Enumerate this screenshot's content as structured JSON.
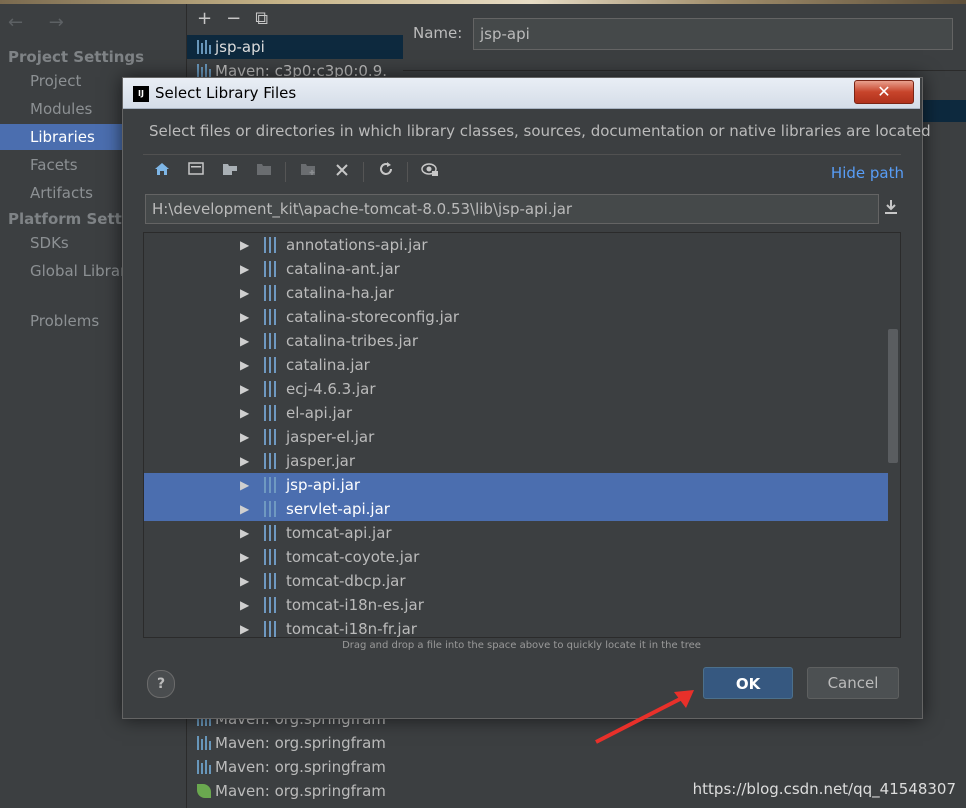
{
  "left_panel": {
    "nav_arrows": "← →",
    "project_settings_title": "Project Settings",
    "project_items": [
      "Project",
      "Modules",
      "Libraries",
      "Facets",
      "Artifacts"
    ],
    "selected_item": "Libraries",
    "platform_settings_title": "Platform Settin",
    "platform_items": [
      "SDKs",
      "Global Librar"
    ],
    "problems": "Problems"
  },
  "middle_panel": {
    "toolbar": [
      "+",
      "−",
      "⧉"
    ],
    "top_libs": [
      "jsp-api",
      "Maven: c3p0:c3p0:0.9."
    ],
    "bottom_libs": [
      "Maven: org.springfram",
      "Maven: org.springfram",
      "Maven: org.springfram",
      "Maven: org.springfram"
    ]
  },
  "right_panel": {
    "name_label": "Name:",
    "name_value": "jsp-api"
  },
  "dialog": {
    "title": "Select Library Files",
    "close_label": "✕",
    "description": "Select files or directories in which library classes, sources, documentation or native libraries are located",
    "hide_path": "Hide path",
    "path": "H:\\development_kit\\apache-tomcat-8.0.53\\lib\\jsp-api.jar",
    "files": [
      "annotations-api.jar",
      "catalina-ant.jar",
      "catalina-ha.jar",
      "catalina-storeconfig.jar",
      "catalina-tribes.jar",
      "catalina.jar",
      "ecj-4.6.3.jar",
      "el-api.jar",
      "jasper-el.jar",
      "jasper.jar",
      "jsp-api.jar",
      "servlet-api.jar",
      "tomcat-api.jar",
      "tomcat-coyote.jar",
      "tomcat-dbcp.jar",
      "tomcat-i18n-es.jar",
      "tomcat-i18n-fr.jar"
    ],
    "selected_files": [
      "jsp-api.jar",
      "servlet-api.jar"
    ],
    "hint": "Drag and drop a file into the space above to quickly locate it in the tree",
    "help_label": "?",
    "ok_label": "OK",
    "cancel_label": "Cancel"
  },
  "watermark": "https://blog.csdn.net/qq_41548307",
  "colors": {
    "selection": "#4b6eaf",
    "link": "#589df6",
    "ok_button": "#365880",
    "annotation_arrow": "#e8302a"
  }
}
